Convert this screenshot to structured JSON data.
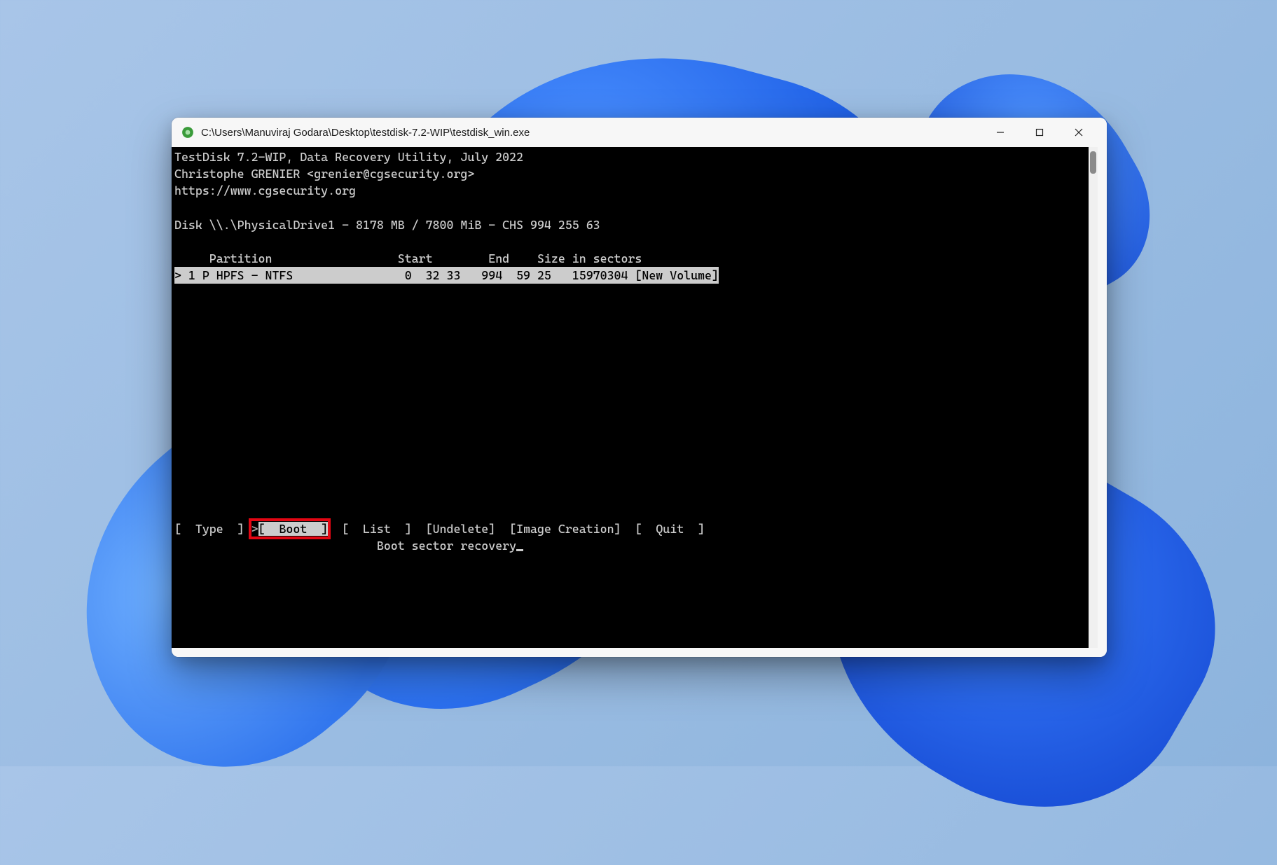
{
  "window": {
    "title": "C:\\Users\\Manuviraj Godara\\Desktop\\testdisk-7.2-WIP\\testdisk_win.exe",
    "controls": {
      "minimize": "min",
      "maximize": "max",
      "close": "close"
    }
  },
  "terminal": {
    "app_line1": "TestDisk 7.2-WIP, Data Recovery Utility, July 2022",
    "app_line2": "Christophe GRENIER <grenier@cgsecurity.org>",
    "app_line3": "https://www.cgsecurity.org",
    "disk_line": "Disk \\\\.\\PhysicalDrive1 - 8178 MB / 7800 MiB - CHS 994 255 63",
    "header_row": "     Partition                  Start        End    Size in sectors",
    "partition_row": "> 1 P HPFS - NTFS                0  32 33   994  59 25   15970304 [New Volume]",
    "menu": {
      "type": "[  Type  ]",
      "boot_prefix": ">",
      "boot": "[  Boot  ]",
      "list": "[  List  ]",
      "undelete": "[Undelete]",
      "image": "[Image Creation]",
      "quit": "[  Quit  ]"
    },
    "hint": "Boot sector recovery"
  },
  "colors": {
    "highlight_red": "#e30613",
    "terminal_bg": "#000000",
    "terminal_fg": "#cccccc"
  }
}
